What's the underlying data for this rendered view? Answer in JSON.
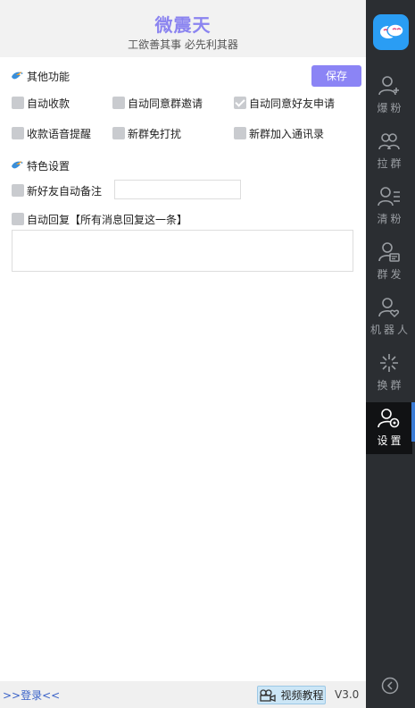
{
  "header": {
    "title": "微震天",
    "slogan": "工欲善其事 必先利其器"
  },
  "other_functions": {
    "title": "其他功能",
    "save_label": "保存",
    "options": [
      {
        "label": "自动收款",
        "checked": false
      },
      {
        "label": "自动同意群邀请",
        "checked": false
      },
      {
        "label": "自动同意好友申请",
        "checked": true
      },
      {
        "label": "收款语音提醒",
        "checked": false
      },
      {
        "label": "新群免打扰",
        "checked": false
      },
      {
        "label": "新群加入通讯录",
        "checked": false
      }
    ]
  },
  "special_settings": {
    "title": "特色设置",
    "new_friend_remark": {
      "label": "新好友自动备注",
      "checked": false,
      "value": ""
    },
    "auto_reply": {
      "label": "自动回复【所有消息回复这一条】",
      "checked": false,
      "value": ""
    }
  },
  "footer": {
    "login_link": ">>登录<<",
    "tutorial_label": "视频教程",
    "version": "V3.0"
  },
  "sidebar": {
    "items": [
      {
        "label": "爆粉",
        "icon": "user-add-icon",
        "active": false
      },
      {
        "label": "拉群",
        "icon": "users-group-icon",
        "active": false
      },
      {
        "label": "清粉",
        "icon": "user-list-icon",
        "active": false
      },
      {
        "label": "群发",
        "icon": "user-message-icon",
        "active": false
      },
      {
        "label": "机器人",
        "icon": "user-heart-icon",
        "active": false
      },
      {
        "label": "换群",
        "icon": "sparkle-icon",
        "active": false
      },
      {
        "label": "设置",
        "icon": "user-gear-icon",
        "active": true
      }
    ]
  },
  "colors": {
    "accent": "#8b84f5",
    "sidebar_bg": "#2b2e32",
    "active_bar": "#3a7bd5",
    "logo_bg": "#2a9df4"
  }
}
